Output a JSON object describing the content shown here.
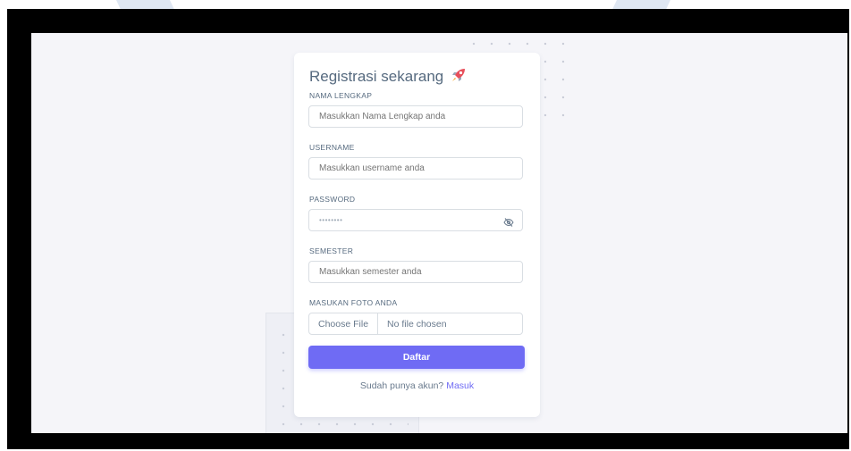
{
  "form": {
    "title": "Registrasi sekarang",
    "title_icon": "rocket-icon",
    "fields": {
      "nama": {
        "label": "NAMA LENGKAP",
        "placeholder": "Masukkan Nama Lengkap anda"
      },
      "username": {
        "label": "USERNAME",
        "placeholder": "Masukkan username anda"
      },
      "password": {
        "label": "PASSWORD",
        "value_masked": "••••••••",
        "toggle_icon": "eye-slash-icon"
      },
      "semester": {
        "label": "SEMESTER",
        "placeholder": "Masukkan semester anda"
      },
      "foto": {
        "label": "MASUKAN FOTO ANDA",
        "button_label": "Choose File",
        "status": "No file chosen"
      }
    },
    "submit_label": "Daftar",
    "footer_text": "Sudah punya akun?",
    "login_link": "Masuk"
  },
  "colors": {
    "primary": "#6f6bf4",
    "text": "#566a7f",
    "placeholder": "#a1acb8",
    "page_bg": "#f5f5f9"
  }
}
